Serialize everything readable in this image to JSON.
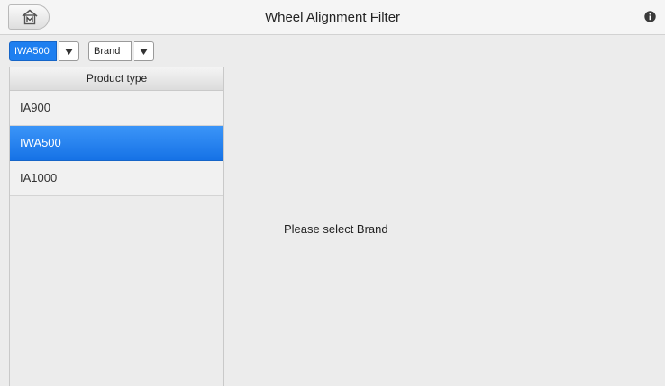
{
  "header": {
    "title": "Wheel Alignment Filter",
    "home_icon": "home-m-icon",
    "info_icon": "info-icon"
  },
  "filters": {
    "product": {
      "value": "IWA500",
      "icon": "chevron-down-icon"
    },
    "brand": {
      "value": "Brand",
      "icon": "chevron-down-icon"
    }
  },
  "product_list": {
    "header": "Product type",
    "items": [
      {
        "label": "IA900",
        "selected": false
      },
      {
        "label": "IWA500",
        "selected": true
      },
      {
        "label": "IA1000",
        "selected": false
      }
    ]
  },
  "main": {
    "message": "Please select Brand"
  },
  "colors": {
    "accent": "#1e7ff0",
    "background": "#ececec"
  }
}
